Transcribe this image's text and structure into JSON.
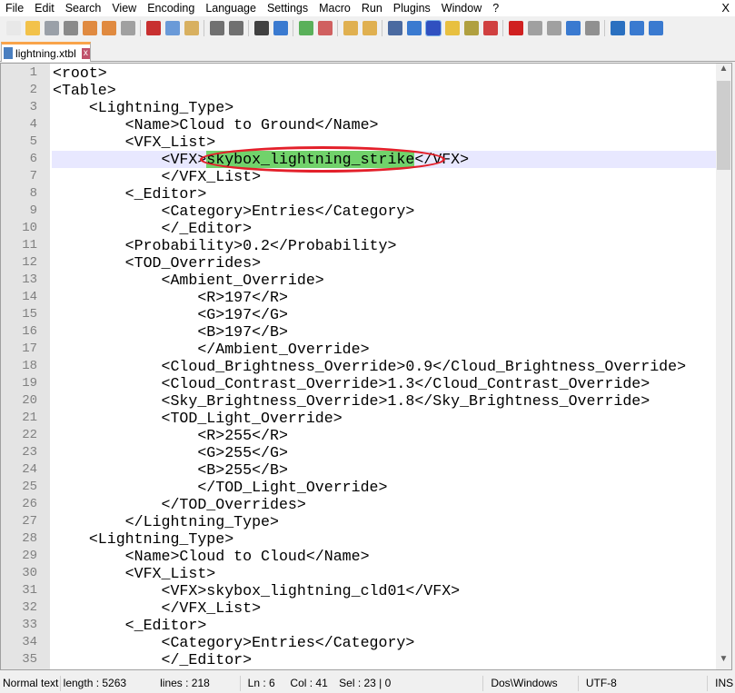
{
  "menu": [
    "File",
    "Edit",
    "Search",
    "View",
    "Encoding",
    "Language",
    "Settings",
    "Macro",
    "Run",
    "Plugins",
    "Window",
    "?"
  ],
  "close_label": "X",
  "toolbar_icons": [
    {
      "name": "new-file",
      "color": "#e8e8e8"
    },
    {
      "name": "open-file",
      "color": "#f2c24a"
    },
    {
      "name": "save",
      "color": "#9aa0a8"
    },
    {
      "name": "save-all",
      "color": "#8a8a8a"
    },
    {
      "name": "close",
      "color": "#e08a40"
    },
    {
      "name": "close-all",
      "color": "#e08a40"
    },
    {
      "name": "print",
      "color": "#a0a0a0"
    },
    "|",
    {
      "name": "cut",
      "color": "#c83030"
    },
    {
      "name": "copy",
      "color": "#6a9ad8"
    },
    {
      "name": "paste",
      "color": "#d8b060"
    },
    "|",
    {
      "name": "undo",
      "color": "#707070"
    },
    {
      "name": "redo",
      "color": "#707070"
    },
    "|",
    {
      "name": "find",
      "color": "#404040"
    },
    {
      "name": "replace",
      "color": "#3a7ad0"
    },
    "|",
    {
      "name": "zoom-in",
      "color": "#5ab05a"
    },
    {
      "name": "zoom-out",
      "color": "#d06060"
    },
    "|",
    {
      "name": "sync-vertical",
      "color": "#e0b050"
    },
    {
      "name": "sync-horizontal",
      "color": "#e0b050"
    },
    "|",
    {
      "name": "word-wrap",
      "color": "#4a6aa0"
    },
    {
      "name": "show-all-chars",
      "color": "#3a7ad0"
    },
    {
      "name": "indent-guide",
      "color": "#3050c0",
      "active": true
    },
    {
      "name": "udl",
      "color": "#e8c040"
    },
    {
      "name": "doc-map",
      "color": "#b0a040"
    },
    {
      "name": "function-list",
      "color": "#d04040"
    },
    "|",
    {
      "name": "record-macro",
      "color": "#d02020"
    },
    {
      "name": "stop-macro",
      "color": "#a0a0a0"
    },
    {
      "name": "play-macro",
      "color": "#a0a0a0"
    },
    {
      "name": "run-macro-multiple",
      "color": "#3a7ad0"
    },
    {
      "name": "save-macro",
      "color": "#909090"
    },
    "|",
    {
      "name": "fold-all",
      "color": "#2a70c0"
    },
    {
      "name": "up",
      "color": "#3a7ad0"
    },
    {
      "name": "down",
      "color": "#3a7ad0"
    }
  ],
  "tab": {
    "label": "lightning.xtbl",
    "close": "x"
  },
  "editor": {
    "current_line": 6,
    "highlight": {
      "line": 6,
      "before": "            <VFX>",
      "match": "skybox_lightning_strike",
      "after": "</VFX>"
    },
    "lines": [
      "<root>",
      "<Table>",
      "    <Lightning_Type>",
      "        <Name>Cloud to Ground</Name>",
      "        <VFX_List>",
      "            <VFX>skybox_lightning_strike</VFX>",
      "            </VFX_List>",
      "        <_Editor>",
      "            <Category>Entries</Category>",
      "            </_Editor>",
      "        <Probability>0.2</Probability>",
      "        <TOD_Overrides>",
      "            <Ambient_Override>",
      "                <R>197</R>",
      "                <G>197</G>",
      "                <B>197</B>",
      "                </Ambient_Override>",
      "            <Cloud_Brightness_Override>0.9</Cloud_Brightness_Override>",
      "            <Cloud_Contrast_Override>1.3</Cloud_Contrast_Override>",
      "            <Sky_Brightness_Override>1.8</Sky_Brightness_Override>",
      "            <TOD_Light_Override>",
      "                <R>255</R>",
      "                <G>255</G>",
      "                <B>255</B>",
      "                </TOD_Light_Override>",
      "            </TOD_Overrides>",
      "        </Lightning_Type>",
      "    <Lightning_Type>",
      "        <Name>Cloud to Cloud</Name>",
      "        <VFX_List>",
      "            <VFX>skybox_lightning_cld01</VFX>",
      "            </VFX_List>",
      "        <_Editor>",
      "            <Category>Entries</Category>",
      "            </_Editor>"
    ]
  },
  "status": {
    "type": "Normal text",
    "length": "length : 5263",
    "lines": "lines : 218",
    "ln": "Ln : 6",
    "col": "Col : 41",
    "sel": "Sel : 23 | 0",
    "eol": "Dos\\Windows",
    "encoding": "UTF-8",
    "mode": "INS"
  }
}
